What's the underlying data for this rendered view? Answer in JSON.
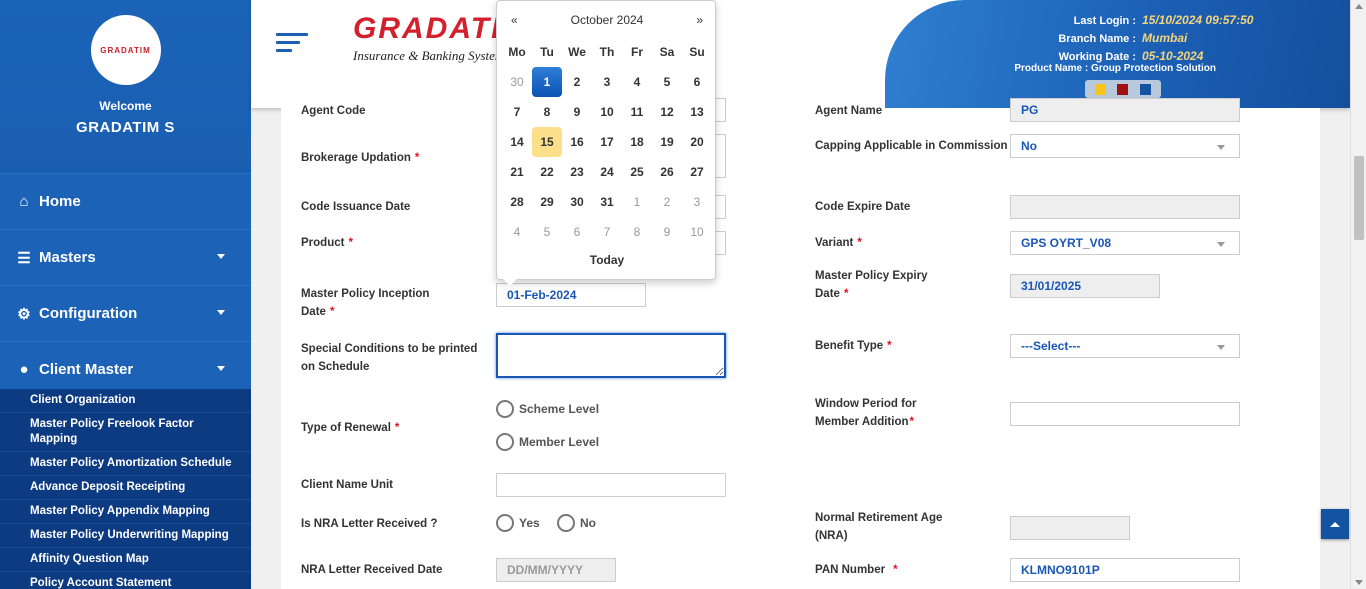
{
  "sidebar": {
    "logo": "GRADATIM",
    "welcome": "Welcome",
    "user": "GRADATIM S",
    "menu": [
      {
        "label": "Home",
        "icon": "home-icon"
      },
      {
        "label": "Masters",
        "icon": "database-icon"
      },
      {
        "label": "Configuration",
        "icon": "cogs-icon"
      },
      {
        "label": "Client Master",
        "icon": "user-icon"
      }
    ],
    "submenu": [
      "Client Organization",
      "Master Policy Freelook Factor Mapping",
      "Master Policy Amortization Schedule",
      "Advance Deposit Receipting",
      "Master Policy Appendix Mapping",
      "Master Policy Underwriting Mapping",
      "Affinity Question Map",
      "Policy Account Statement"
    ]
  },
  "header": {
    "brand": "GRADATIM",
    "brand_sub": "Insurance & Banking System,",
    "last_login_label": "Last Login :",
    "last_login": "15/10/2024 09:57:50",
    "branch_label": "Branch Name :",
    "branch": "Mumbai",
    "working_date_label": "Working Date :",
    "working_date": "05-10-2024",
    "product": "Product Name : Group Protection Solution",
    "theme_colors": [
      "#f5c518",
      "#a01010",
      "#1452a2"
    ]
  },
  "calendar": {
    "title": "October 2024",
    "prev": "«",
    "next": "»",
    "dow": [
      "Mo",
      "Tu",
      "We",
      "Th",
      "Fr",
      "Sa",
      "Su"
    ],
    "days": [
      "30",
      "1",
      "2",
      "3",
      "4",
      "5",
      "6",
      "7",
      "8",
      "9",
      "10",
      "11",
      "12",
      "13",
      "14",
      "15",
      "16",
      "17",
      "18",
      "19",
      "20",
      "21",
      "22",
      "23",
      "24",
      "25",
      "26",
      "27",
      "28",
      "29",
      "30",
      "31",
      "1",
      "2",
      "3",
      "4",
      "5",
      "6",
      "7",
      "8",
      "9",
      "10"
    ],
    "today": "Today",
    "selected": "1",
    "highlighted": "15"
  },
  "form": {
    "agent_code": "Agent Code",
    "agent_name": "Agent Name",
    "agent_name_value": "PG",
    "brokerage": "Brokerage Updation",
    "capping": "Capping Applicable in Commission",
    "capping_value": "No",
    "code_issuance": "Code Issuance Date",
    "code_expire": "Code Expire Date",
    "product": "Product",
    "variant": "Variant",
    "variant_value": "GPS OYRT_V08",
    "mp_inception": "Master Policy Inception Date",
    "mp_inception_value": "01-Feb-2024",
    "mp_expiry": "Master Policy Expiry Date",
    "mp_expiry_value": "31/01/2025",
    "special": "Special Conditions to be printed on Schedule",
    "benefit": "Benefit Type",
    "benefit_value": "---Select---",
    "renewal": "Type of Renewal",
    "scheme": "Scheme Level",
    "member": "Member Level",
    "window": "Window Period for Member Addition",
    "client_unit": "Client Name Unit",
    "nra": "Is NRA Letter Received ?",
    "yes": "Yes",
    "no": "No",
    "nra_age": "Normal Retirement Age (NRA)",
    "nra_date": "NRA Letter Received Date",
    "nra_date_ph": "DD/MM/YYYY",
    "pan": "PAN Number",
    "pan_value": "KLMNO9101P"
  }
}
